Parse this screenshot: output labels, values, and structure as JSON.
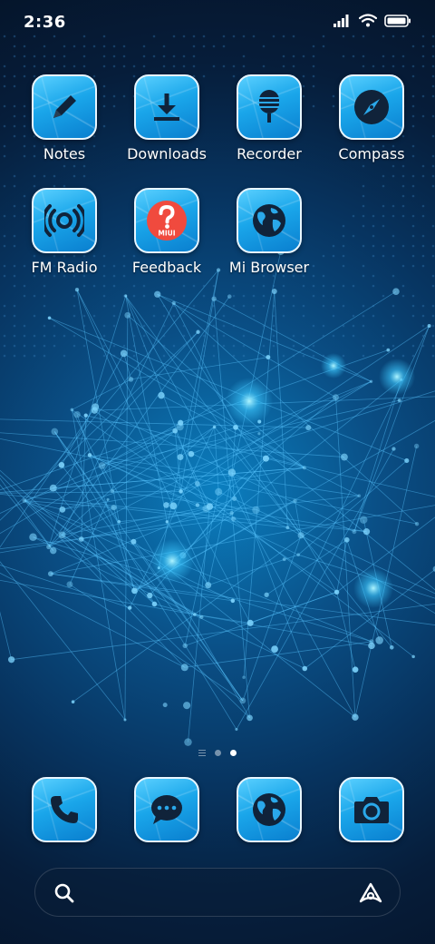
{
  "status": {
    "time": "2:36",
    "icons": [
      "signal-icon",
      "wifi-icon",
      "battery-icon"
    ]
  },
  "apps": [
    {
      "label": "Notes",
      "icon": "pencil-icon"
    },
    {
      "label": "Downloads",
      "icon": "download-icon"
    },
    {
      "label": "Recorder",
      "icon": "microphone-icon"
    },
    {
      "label": "Compass",
      "icon": "compass-icon"
    },
    {
      "label": "FM Radio",
      "icon": "radio-icon"
    },
    {
      "label": "Feedback",
      "icon": "feedback-icon",
      "badge_text": "MIUI"
    },
    {
      "label": "Mi Browser",
      "icon": "globe-icon"
    }
  ],
  "page_indicator": {
    "pages": 2,
    "current": 2
  },
  "dock": [
    {
      "icon": "phone-icon"
    },
    {
      "icon": "messages-icon"
    },
    {
      "icon": "globe-icon"
    },
    {
      "icon": "camera-icon"
    }
  ],
  "colors": {
    "tile_light": "#5ad0ff",
    "tile_dark": "#0a7fcf",
    "feedback_red": "#f04a3e",
    "background": "#073460"
  }
}
